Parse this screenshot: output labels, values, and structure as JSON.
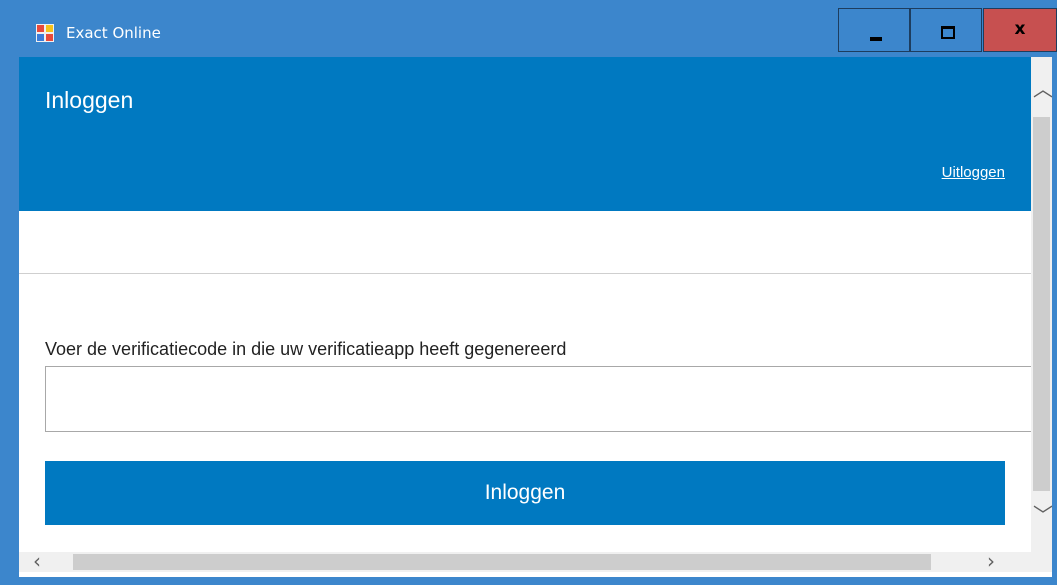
{
  "window": {
    "title": "Exact Online",
    "app_icon": "windows-app-icon",
    "controls": {
      "minimize_icon": "minimize-icon",
      "maximize_icon": "maximize-icon",
      "close_label": "x"
    }
  },
  "header": {
    "title": "Inloggen",
    "logout_label": "Uitloggen"
  },
  "form": {
    "code_label": "Voer de verificatiecode in die uw verificatieapp heeft gegenereerd",
    "code_value": "",
    "code_placeholder": "",
    "submit_label": "Inloggen"
  },
  "colors": {
    "accent": "#0079c1",
    "titlebar": "#3c86cc",
    "close_button": "#c75050"
  }
}
